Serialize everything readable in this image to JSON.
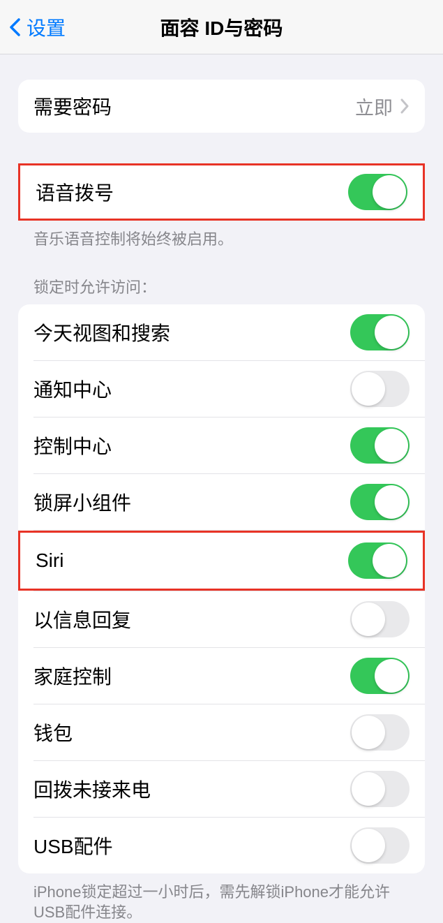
{
  "header": {
    "back_label": "设置",
    "title": "面容 ID与密码"
  },
  "require_passcode": {
    "label": "需要密码",
    "value": "立即"
  },
  "voice_dial": {
    "label": "语音拨号",
    "enabled": true
  },
  "voice_dial_footer": "音乐语音控制将始终被启用。",
  "lock_access_header": "锁定时允许访问：",
  "lock_access": [
    {
      "label": "今天视图和搜索",
      "enabled": true
    },
    {
      "label": "通知中心",
      "enabled": false
    },
    {
      "label": "控制中心",
      "enabled": true
    },
    {
      "label": "锁屏小组件",
      "enabled": true
    },
    {
      "label": "Siri",
      "enabled": true
    },
    {
      "label": "以信息回复",
      "enabled": false
    },
    {
      "label": "家庭控制",
      "enabled": true
    },
    {
      "label": "钱包",
      "enabled": false
    },
    {
      "label": "回拨未接来电",
      "enabled": false
    },
    {
      "label": "USB配件",
      "enabled": false
    }
  ],
  "usb_footer": "iPhone锁定超过一小时后，需先解锁iPhone才能允许USB配件连接。",
  "highlights": {
    "voice_dial_row": true,
    "siri_row_index": 4
  },
  "colors": {
    "accent": "#007aff",
    "toggle_on": "#34c759",
    "toggle_off": "#e9e9eb",
    "highlight_border": "#e83326"
  }
}
